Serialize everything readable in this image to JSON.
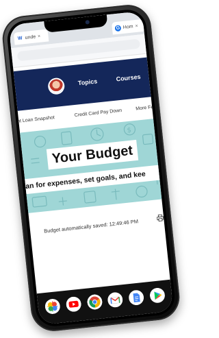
{
  "browser": {
    "tabs": [
      {
        "label": "unde",
        "favicon": "W",
        "close": "×"
      },
      {
        "label": "Hom",
        "favicon": "G",
        "close": "×"
      }
    ]
  },
  "site": {
    "nav": {
      "topics": "Topics",
      "courses": "Courses"
    },
    "sublinks": [
      "ent Loan Snapshot",
      "Credit Card Pay Down",
      "More Fe"
    ],
    "hero": {
      "title": "Your Budget",
      "subtitle": "an for expenses, set goals, and kee"
    },
    "status": {
      "saved_text": "Budget automatically saved: 12:49:46 PM"
    }
  },
  "dock": {
    "apps": [
      "photos-icon",
      "youtube-icon",
      "chrome-icon",
      "gmail-icon",
      "docs-icon",
      "play-store-icon"
    ]
  },
  "colors": {
    "nav_bg": "#14275a",
    "hero_bg": "#9fd6d6",
    "tab_strip": "#dfe3e8"
  }
}
